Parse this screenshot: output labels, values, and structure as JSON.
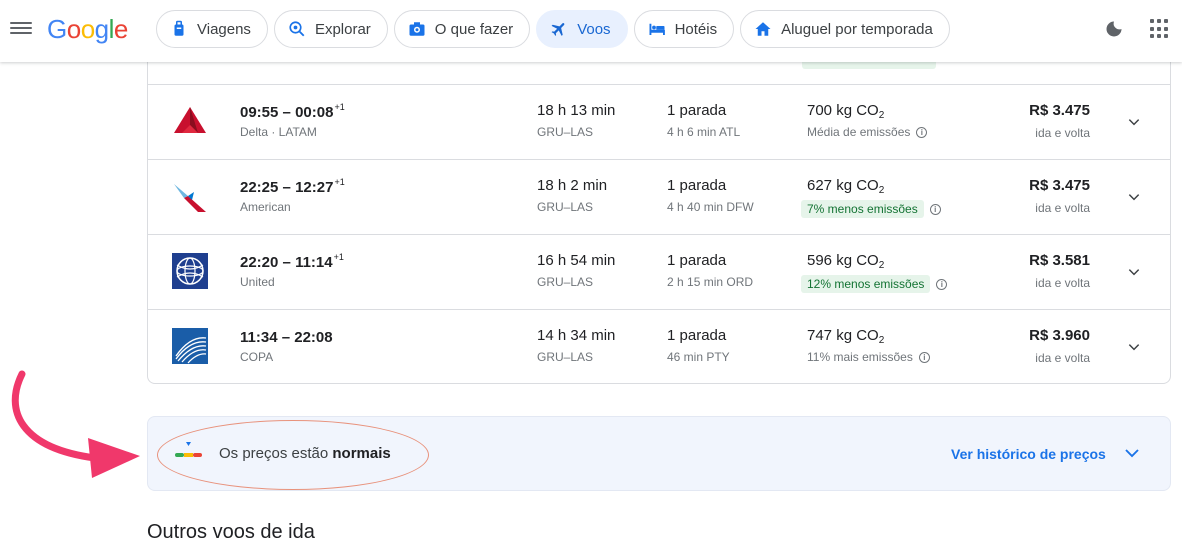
{
  "header": {
    "logo_letters": [
      "G",
      "o",
      "o",
      "g",
      "l",
      "e"
    ],
    "nav": [
      {
        "label": "Viagens",
        "icon": "luggage-icon"
      },
      {
        "label": "Explorar",
        "icon": "explore-icon"
      },
      {
        "label": "O que fazer",
        "icon": "camera-icon"
      },
      {
        "label": "Voos",
        "icon": "plane-icon",
        "active": true
      },
      {
        "label": "Hotéis",
        "icon": "bed-icon"
      },
      {
        "label": "Aluguel por temporada",
        "icon": "home-icon"
      }
    ]
  },
  "flights": [
    {
      "depart": "09:55",
      "arrive": "00:08",
      "day_offset": "+1",
      "airline": "Delta · LATAM",
      "duration": "18 h 13 min",
      "route": "GRU–LAS",
      "stops": "1 parada",
      "layover": "4 h 6 min ATL",
      "co2": "700 kg CO",
      "co2_sub": "2",
      "emissions": "Média de emissões",
      "emissions_good": false,
      "price": "R$ 3.475",
      "trip": "ida e volta",
      "logo": "delta-logo-icon"
    },
    {
      "depart": "22:25",
      "arrive": "12:27",
      "day_offset": "+1",
      "airline": "American",
      "duration": "18 h 2 min",
      "route": "GRU–LAS",
      "stops": "1 parada",
      "layover": "4 h 40 min DFW",
      "co2": "627 kg CO",
      "co2_sub": "2",
      "emissions": "7% menos emissões",
      "emissions_good": true,
      "price": "R$ 3.475",
      "trip": "ida e volta",
      "logo": "american-logo-icon"
    },
    {
      "depart": "22:20",
      "arrive": "11:14",
      "day_offset": "+1",
      "airline": "United",
      "duration": "16 h 54 min",
      "route": "GRU–LAS",
      "stops": "1 parada",
      "layover": "2 h 15 min ORD",
      "co2": "596 kg CO",
      "co2_sub": "2",
      "emissions": "12% menos emissões",
      "emissions_good": true,
      "price": "R$ 3.581",
      "trip": "ida e volta",
      "logo": "united-logo-icon"
    },
    {
      "depart": "11:34",
      "arrive": "22:08",
      "day_offset": "",
      "airline": "COPA",
      "duration": "14 h 34 min",
      "route": "GRU–LAS",
      "stops": "1 parada",
      "layover": "46 min PTY",
      "co2": "747 kg CO",
      "co2_sub": "2",
      "emissions": "11% mais emissões",
      "emissions_good": false,
      "price": "R$ 3.960",
      "trip": "ida e volta",
      "logo": "copa-logo-icon"
    }
  ],
  "insight": {
    "prefix": "Os preços estão ",
    "status": "normais",
    "link": "Ver histórico de preços"
  },
  "section_title": "Outros voos de ida",
  "colors": {
    "accent": "#1a73e8",
    "annotation_arrow": "#f0386b",
    "annotation_ellipse": "#e8927c"
  }
}
